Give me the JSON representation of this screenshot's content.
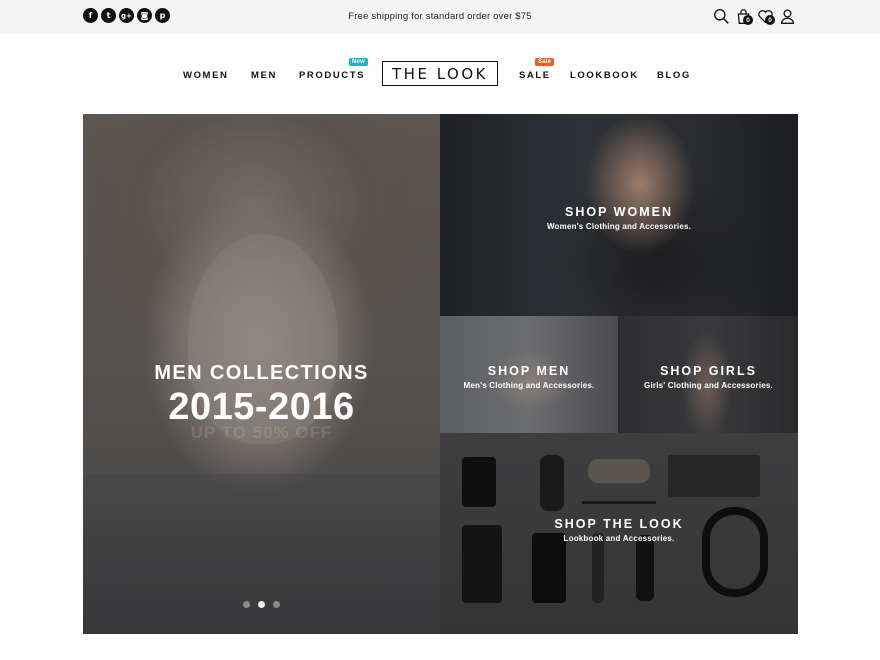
{
  "topbar": {
    "social_icons": [
      {
        "name": "facebook-icon",
        "glyph": "f"
      },
      {
        "name": "twitter-icon",
        "glyph": "t"
      },
      {
        "name": "google-plus-icon",
        "glyph": "g+"
      },
      {
        "name": "instagram-icon",
        "glyph": "◙"
      },
      {
        "name": "pinterest-icon",
        "glyph": "p"
      }
    ],
    "promo_text": "Free shipping for standard order over $75",
    "cart_count": "0",
    "wishlist_count": "0"
  },
  "nav": {
    "women": "WOMEN",
    "men": "MEN",
    "products": "PRODUCTS",
    "products_tag": "New",
    "products_tag_color": "#1bb6c6",
    "logo": "THE LOOK",
    "sale": "SALE",
    "sale_tag": "Sale",
    "sale_tag_color": "#f05a28",
    "lookbook": "LOOKBOOK",
    "blog": "BLOG"
  },
  "hero": {
    "main": {
      "title": "MEN COLLECTIONS",
      "years": "2015-2016",
      "ghost_text": "UP TO 50% OFF",
      "slides": 3,
      "active_slide": 2
    },
    "women": {
      "title": "SHOP WOMEN",
      "subtitle": "Women's Clothing and Accessories."
    },
    "men": {
      "title": "SHOP MEN",
      "subtitle": "Men's Clothing and Accessories."
    },
    "girls": {
      "title": "SHOP GIRLS",
      "subtitle": "Girls' Clothing and Accessories."
    },
    "look": {
      "title": "SHOP THE LOOK",
      "subtitle": "Lookbook and Accessories."
    }
  }
}
